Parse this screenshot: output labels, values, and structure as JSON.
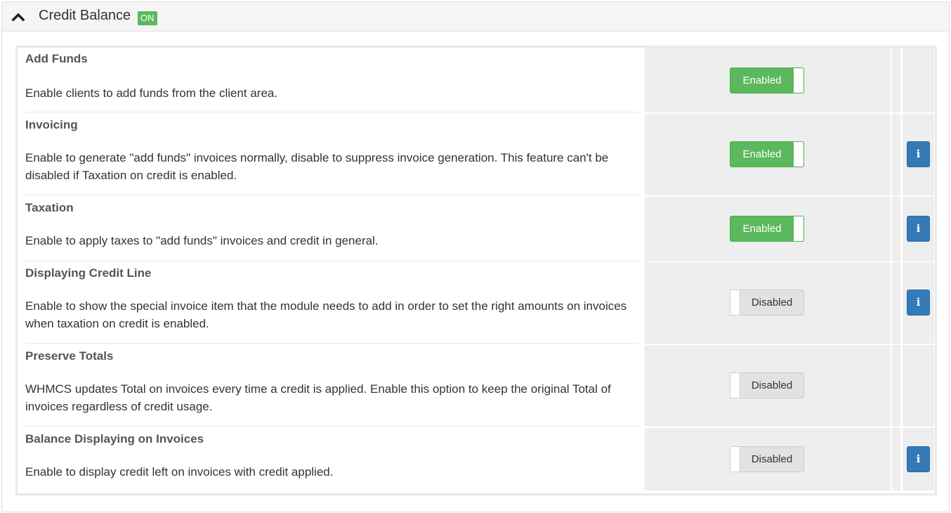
{
  "panel": {
    "title": "Credit Balance",
    "status_badge": "ON"
  },
  "settings": [
    {
      "title": "Add Funds",
      "description": "Enable clients to add funds from the client area.",
      "toggle": "Enabled",
      "enabled": true,
      "has_info": false
    },
    {
      "title": "Invoicing",
      "description": "Enable to generate \"add funds\" invoices normally, disable to suppress invoice generation. This feature can't be disabled if Taxation on credit is enabled.",
      "toggle": "Enabled",
      "enabled": true,
      "has_info": true
    },
    {
      "title": "Taxation",
      "description": "Enable to apply taxes to \"add funds\" invoices and credit in general.",
      "toggle": "Enabled",
      "enabled": true,
      "has_info": true
    },
    {
      "title": "Displaying Credit Line",
      "description": "Enable to show the special invoice item that the module needs to add in order to set the right amounts on invoices when taxation on credit is enabled.",
      "toggle": "Disabled",
      "enabled": false,
      "has_info": true
    },
    {
      "title": "Preserve Totals",
      "description": "WHMCS updates Total on invoices every time a credit is applied. Enable this option to keep the original Total of invoices regardless of credit usage.",
      "toggle": "Disabled",
      "enabled": false,
      "has_info": false
    },
    {
      "title": "Balance Displaying on Invoices",
      "description": "Enable to display credit left on invoices with credit applied.",
      "toggle": "Disabled",
      "enabled": false,
      "has_info": true
    }
  ],
  "info_icon_glyph": "i",
  "colors": {
    "enabled_green": "#5cb85c",
    "info_blue": "#337ab7",
    "cell_gray": "#eeeeee"
  }
}
